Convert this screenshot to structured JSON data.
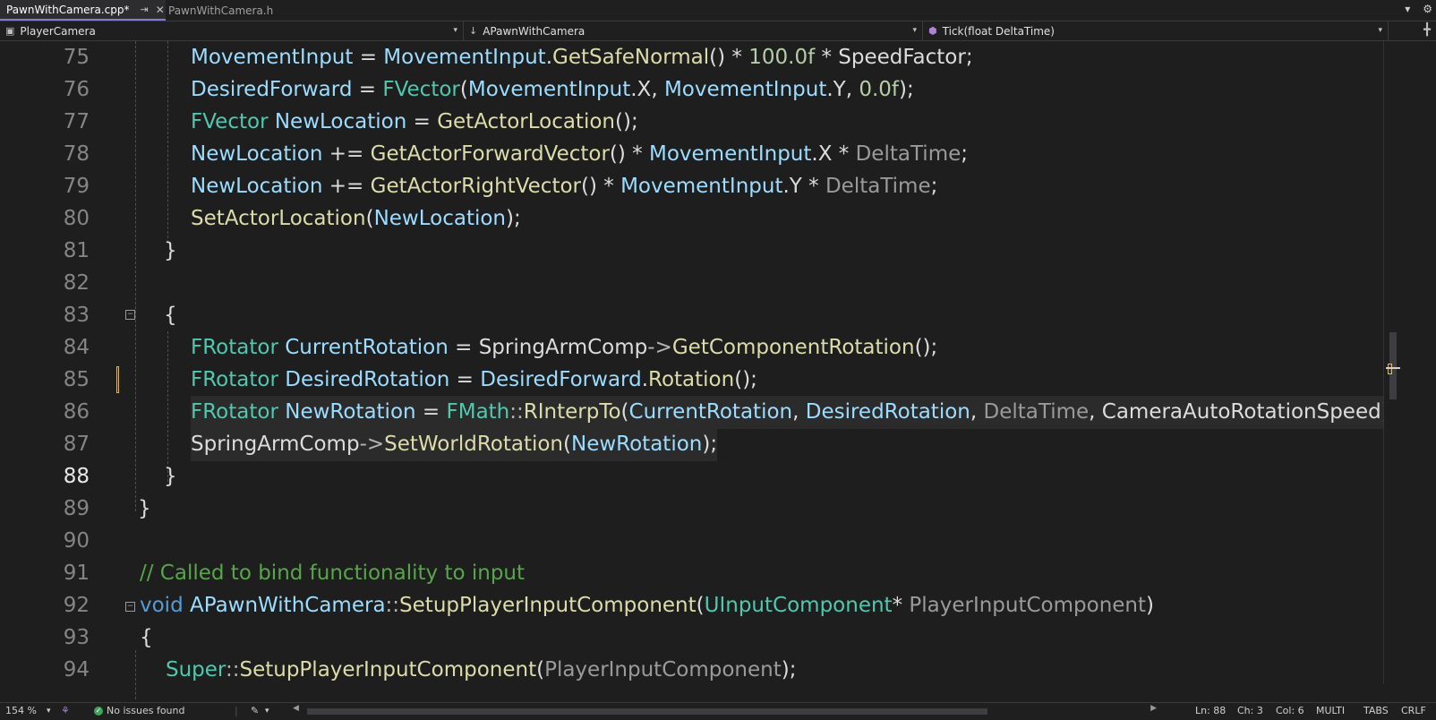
{
  "tabs": [
    {
      "label": "PawnWithCamera.cpp*"
    },
    {
      "label": "PawnWithCamera.h"
    }
  ],
  "nav": {
    "project": "PlayerCamera",
    "class": "APawnWithCamera",
    "member": "Tick(float DeltaTime)"
  },
  "editor": {
    "current_line": 88,
    "lines": [
      {
        "n": "75",
        "code": "MovementInput = MovementInput.GetSafeNormal() * 100.0f * SpeedFactor;"
      },
      {
        "n": "76",
        "code": "DesiredForward = FVector(MovementInput.X, MovementInput.Y, 0.0f);"
      },
      {
        "n": "77",
        "code": "FVector NewLocation = GetActorLocation();"
      },
      {
        "n": "78",
        "code": "NewLocation += GetActorForwardVector() * MovementInput.X * DeltaTime;"
      },
      {
        "n": "79",
        "code": "NewLocation += GetActorRightVector() * MovementInput.Y * DeltaTime;"
      },
      {
        "n": "80",
        "code": "SetActorLocation(NewLocation);"
      },
      {
        "n": "81",
        "code": "}"
      },
      {
        "n": "82",
        "code": ""
      },
      {
        "n": "83",
        "code": "{"
      },
      {
        "n": "84",
        "code": "FRotator CurrentRotation = SpringArmComp->GetComponentRotation();"
      },
      {
        "n": "85",
        "code": "FRotator DesiredRotation = DesiredForward.Rotation();"
      },
      {
        "n": "86",
        "code": "FRotator NewRotation = FMath::RInterpTo(CurrentRotation, DesiredRotation, DeltaTime, CameraAutoRotationSpeed);"
      },
      {
        "n": "87",
        "code": "SpringArmComp->SetWorldRotation(NewRotation);"
      },
      {
        "n": "88",
        "code": "}"
      },
      {
        "n": "89",
        "code": "}"
      },
      {
        "n": "90",
        "code": ""
      },
      {
        "n": "91",
        "code": "// Called to bind functionality to input"
      },
      {
        "n": "92",
        "code": "void APawnWithCamera::SetupPlayerInputComponent(UInputComponent* PlayerInputComponent)"
      },
      {
        "n": "93",
        "code": "{"
      },
      {
        "n": "94",
        "code": "Super::SetupPlayerInputComponent(PlayerInputComponent);"
      }
    ]
  },
  "status": {
    "zoom": "154 %",
    "issues": "No issues found",
    "ln": "Ln: 88",
    "ch": "Ch: 3",
    "col": "Col: 6",
    "encoding": "MULTI",
    "indent": "TABS",
    "line_ending": "CRLF"
  },
  "icons": [
    "close-icon",
    "pin-icon",
    "dropdown-icon",
    "settings-icon",
    "class-icon",
    "method-icon",
    "split-icon",
    "check-icon",
    "brush-icon",
    "arrow-right-icon"
  ],
  "colors": {
    "background": "#1e1e1e",
    "keyword": "#569cd6",
    "type": "#4ec9b0",
    "function": "#dcdcaa",
    "variable": "#9cdcfe",
    "number": "#b5cea8",
    "comment": "#57a64a",
    "change_marker": "#d7ba7d"
  }
}
